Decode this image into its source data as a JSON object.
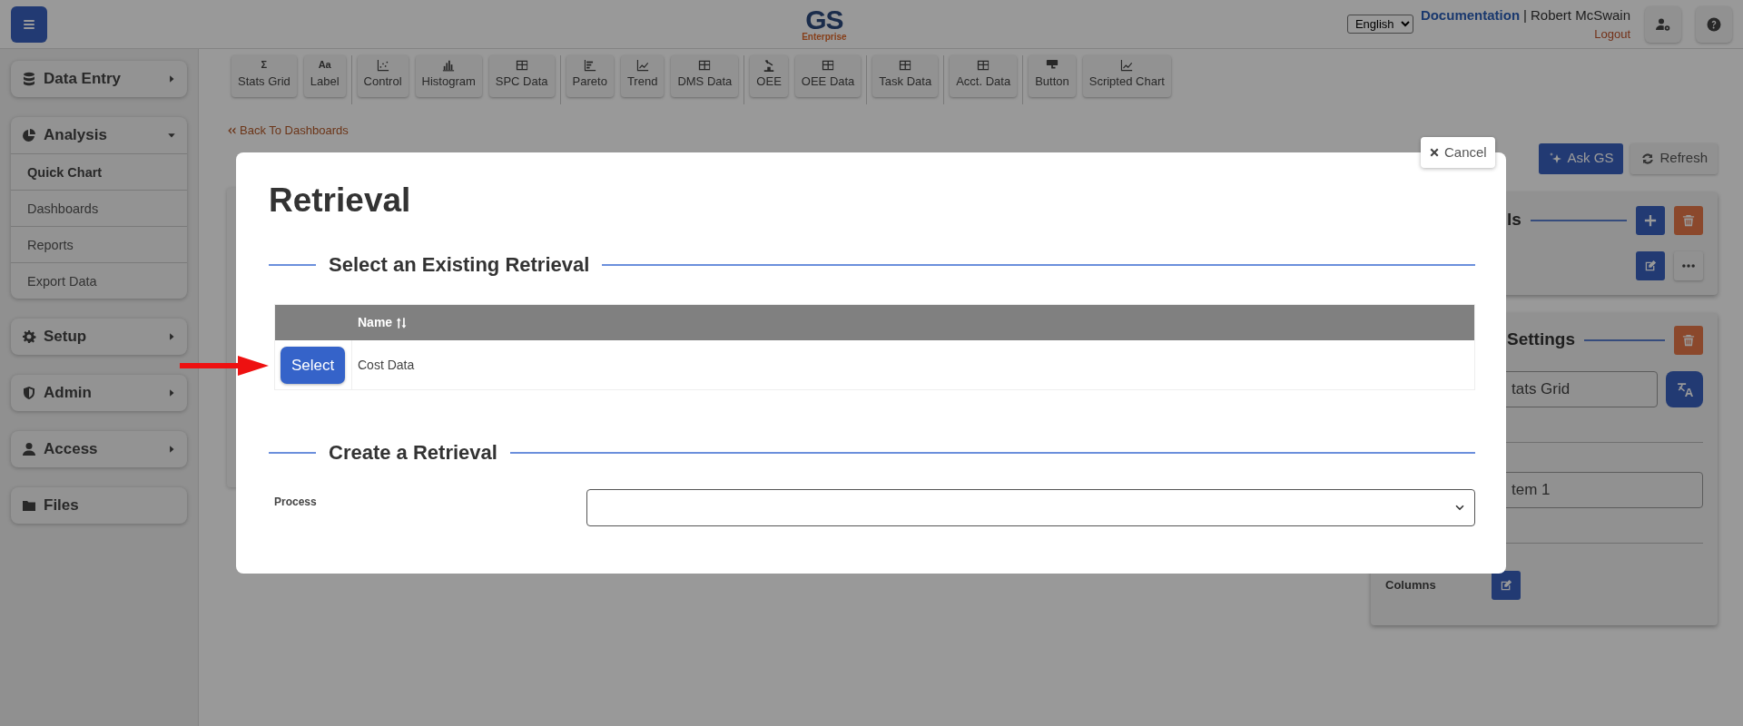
{
  "logo": {
    "title": "GS",
    "subtitle": "Enterprise"
  },
  "header": {
    "language": "English",
    "documentation_link": "Documentation",
    "separator": "|",
    "user": "Robert McSwain",
    "logout": "Logout"
  },
  "sidebar": [
    {
      "label": "Data Entry",
      "expandable": true,
      "expanded": false
    },
    {
      "label": "Analysis",
      "expandable": true,
      "expanded": true,
      "children": [
        {
          "label": "Quick Chart",
          "selected": true
        },
        {
          "label": "Dashboards",
          "selected": false
        },
        {
          "label": "Reports",
          "selected": false
        },
        {
          "label": "Export Data",
          "selected": false
        }
      ]
    },
    {
      "label": "Setup",
      "expandable": true,
      "expanded": false
    },
    {
      "label": "Admin",
      "expandable": true,
      "expanded": false
    },
    {
      "label": "Access",
      "expandable": true,
      "expanded": false
    },
    {
      "label": "Files",
      "expandable": false,
      "expanded": false
    }
  ],
  "toolbar": [
    [
      {
        "label": "Stats Grid",
        "glyph": "Σ"
      },
      {
        "label": "Label",
        "glyph": "Aa"
      }
    ],
    [
      {
        "label": "Control"
      },
      {
        "label": "Histogram"
      },
      {
        "label": "SPC Data"
      }
    ],
    [
      {
        "label": "Pareto"
      },
      {
        "label": "Trend"
      },
      {
        "label": "DMS Data"
      }
    ],
    [
      {
        "label": "OEE"
      },
      {
        "label": "OEE Data"
      }
    ],
    [
      {
        "label": "Task Data"
      }
    ],
    [
      {
        "label": "Acct. Data"
      }
    ],
    [
      {
        "label": "Button"
      },
      {
        "label": "Scripted Chart"
      }
    ]
  ],
  "breadcrumb": {
    "label": "Back To Dashboards"
  },
  "actions": [
    {
      "label": "Ask GS",
      "kind": "primary"
    },
    {
      "label": "Refresh",
      "kind": "light"
    }
  ],
  "panels": {
    "details_heading": "ls",
    "settings_heading": "Settings",
    "title_value": "tats Grid",
    "item_value": "tem 1",
    "columns_label": "Columns"
  },
  "dialog": {
    "cancel": "Cancel",
    "title": "Retrieval",
    "existing_section": "Select an Existing Retrieval",
    "table": {
      "columns": [
        {
          "label": "Name",
          "sortable": true
        }
      ],
      "rows": [
        {
          "action": "Select",
          "name": "Cost Data"
        }
      ]
    },
    "create_section": "Create a Retrieval",
    "process_label": "Process"
  }
}
